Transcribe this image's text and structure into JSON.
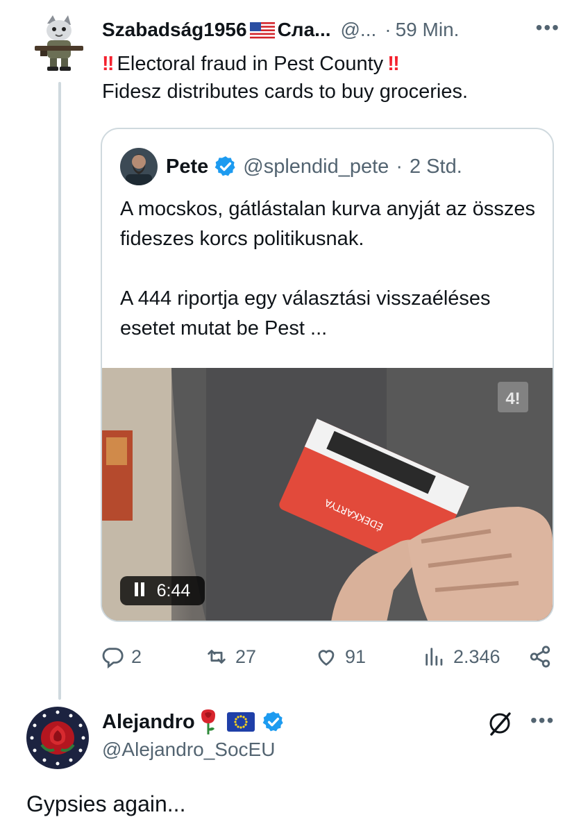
{
  "parent_tweet": {
    "display_name": "Szabadság1956",
    "name_extra": "Сла...",
    "handle": "@...",
    "separator": "·",
    "time": "59 Min.",
    "more": "•••",
    "emoji_before": "‼",
    "emoji_after": "‼",
    "line1": "Electoral fraud in Pest County",
    "line2": "Fidesz distributes cards to buy groceries."
  },
  "quoted_tweet": {
    "display_name": "Pete",
    "handle": "@splendid_pete",
    "separator": "·",
    "time": "2 Std.",
    "paragraph1": "A mocskos, gátlástalan kurva anyját az összes fideszes korcs politikusnak.",
    "paragraph2": "A 444 riportja egy választási visszaéléses esetet mutat be Pest ...",
    "video": {
      "duration": "6:44",
      "watermark": "4!",
      "card_text": "ÉDEKKARTYA"
    }
  },
  "actions": {
    "replies": "2",
    "reposts": "27",
    "likes": "91",
    "views": "2.346"
  },
  "reply_tweet": {
    "display_name": "Alejandro",
    "handle": "@Alejandro_SocEU",
    "more": "•••",
    "text": "Gypsies again..."
  },
  "colors": {
    "text": "#0f1419",
    "muted": "#536471",
    "verified": "#1d9bf0",
    "bang": "#f4212e",
    "border": "#cfd9de"
  },
  "icons": [
    "reply-icon",
    "repost-icon",
    "like-icon",
    "views-icon",
    "share-icon",
    "verified-icon",
    "grok-icon",
    "pause-icon",
    "us-flag-icon",
    "eu-flag-icon",
    "rose-icon"
  ]
}
